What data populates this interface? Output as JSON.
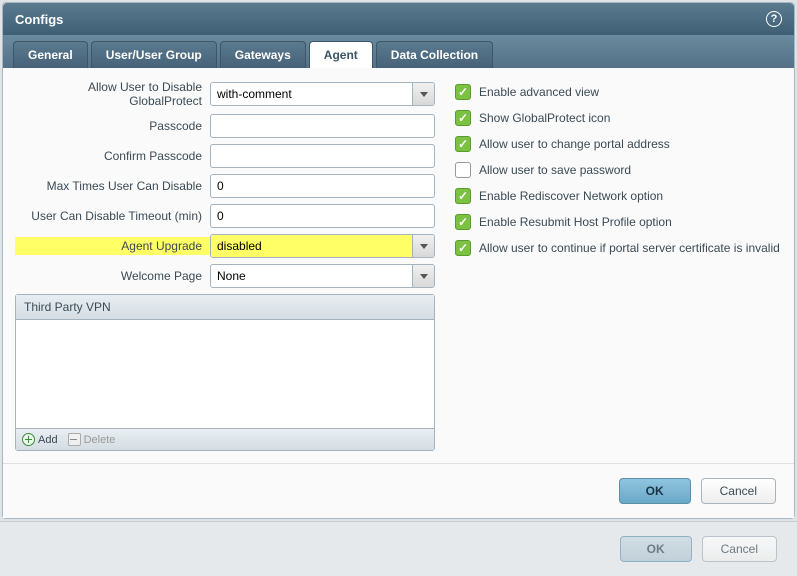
{
  "title": "Configs",
  "tabs": [
    "General",
    "User/User Group",
    "Gateways",
    "Agent",
    "Data Collection"
  ],
  "activeTab": 3,
  "form": {
    "allowDisable": {
      "label": "Allow User to Disable GlobalProtect",
      "value": "with-comment"
    },
    "passcode": {
      "label": "Passcode",
      "value": ""
    },
    "confirmPasscode": {
      "label": "Confirm Passcode",
      "value": ""
    },
    "maxTimes": {
      "label": "Max Times User Can Disable",
      "value": "0"
    },
    "timeout": {
      "label": "User Can Disable Timeout (min)",
      "value": "0"
    },
    "agentUpgrade": {
      "label": "Agent Upgrade",
      "value": "disabled"
    },
    "welcomePage": {
      "label": "Welcome Page",
      "value": "None"
    }
  },
  "listbox": {
    "header": "Third Party VPN",
    "add": "Add",
    "delete": "Delete"
  },
  "checks": [
    {
      "label": "Enable advanced view",
      "checked": true
    },
    {
      "label": "Show GlobalProtect icon",
      "checked": true
    },
    {
      "label": "Allow user to change portal address",
      "checked": true
    },
    {
      "label": "Allow user to save password",
      "checked": false
    },
    {
      "label": "Enable Rediscover Network option",
      "checked": true
    },
    {
      "label": "Enable Resubmit Host Profile option",
      "checked": true
    },
    {
      "label": "Allow user to continue if portal server certificate is invalid",
      "checked": true
    }
  ],
  "buttons": {
    "ok": "OK",
    "cancel": "Cancel"
  }
}
